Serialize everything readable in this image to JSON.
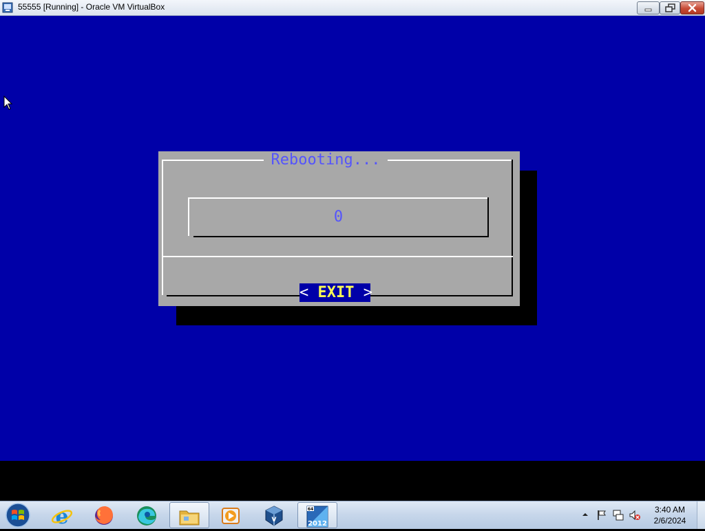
{
  "window": {
    "title": "55555 [Running] - Oracle VM VirtualBox",
    "icon": "virtualbox-icon",
    "controls": [
      "minimize-icon",
      "restore-icon",
      "close-icon"
    ]
  },
  "console": {
    "background_color": "#0000a8",
    "dialog": {
      "title": "Rebooting...",
      "gauge_value": "0",
      "button_left": "<",
      "button_label": "EXIT",
      "button_right": ">"
    }
  },
  "taskbar": {
    "start_icon": "windows-start-icon",
    "pinned": [
      {
        "name": "internet-explorer-icon"
      },
      {
        "name": "firefox-icon"
      },
      {
        "name": "edge-icon"
      },
      {
        "name": "file-explorer-icon"
      },
      {
        "name": "media-player-icon"
      },
      {
        "name": "virtualbox-icon"
      },
      {
        "name": "vm-2012-icon",
        "label": "2012",
        "badge": "64"
      }
    ],
    "tray_icons": [
      "show-hidden-icons-arrow",
      "action-center-flag-icon",
      "network-icon",
      "volume-muted-icon"
    ],
    "clock": {
      "time": "3:40 AM",
      "date": "2/6/2024"
    }
  }
}
